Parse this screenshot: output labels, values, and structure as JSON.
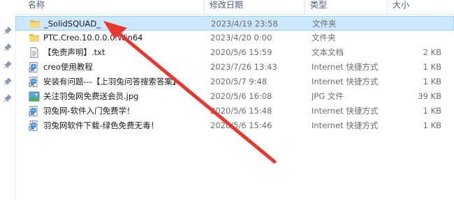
{
  "columns": {
    "name": "名称",
    "date": "修改日期",
    "type": "类型",
    "size": "大小"
  },
  "files": [
    {
      "name": "_SolidSQUAD_",
      "date": "2023/4/19 23:58",
      "type": "文件夹",
      "size": "",
      "icon": "folder-icon",
      "selected": true
    },
    {
      "name": "PTC.Creo.10.0.0.0.Win64",
      "date": "2023/4/20 0:00",
      "type": "文件夹",
      "size": "",
      "icon": "folder-icon",
      "selected": false
    },
    {
      "name": "【免责声明】.txt",
      "date": "2020/5/6 15:59",
      "type": "文本文档",
      "size": "2 KB",
      "icon": "text-file-icon",
      "selected": false
    },
    {
      "name": "creo使用教程",
      "date": "2023/7/26 13:43",
      "type": "Internet 快捷方式",
      "size": "1 KB",
      "icon": "internet-shortcut-icon",
      "selected": false
    },
    {
      "name": "安装有问题---【上羽兔问答搜索答案】",
      "date": "2020/5/7 9:48",
      "type": "Internet 快捷方式",
      "size": "1 KB",
      "icon": "internet-shortcut-icon",
      "selected": false
    },
    {
      "name": "关注羽兔网免费送会员.jpg",
      "date": "2020/5/6 16:08",
      "type": "JPG 文件",
      "size": "39 KB",
      "icon": "image-file-icon",
      "selected": false
    },
    {
      "name": "羽兔网-软件入门免费学！",
      "date": "2020/5/6 15:48",
      "type": "Internet 快捷方式",
      "size": "1 KB",
      "icon": "internet-shortcut-icon",
      "selected": false
    },
    {
      "name": "羽兔网软件下载-绿色免费无毒！",
      "date": "2020/5/6 15:46",
      "type": "Internet 快捷方式",
      "size": "1 KB",
      "icon": "internet-shortcut-icon",
      "selected": false
    }
  ],
  "colors": {
    "selection_bg": "#cce8ff",
    "selection_border": "#99d1ff",
    "folder": "#f8d775",
    "arrow": "#e8372c"
  }
}
